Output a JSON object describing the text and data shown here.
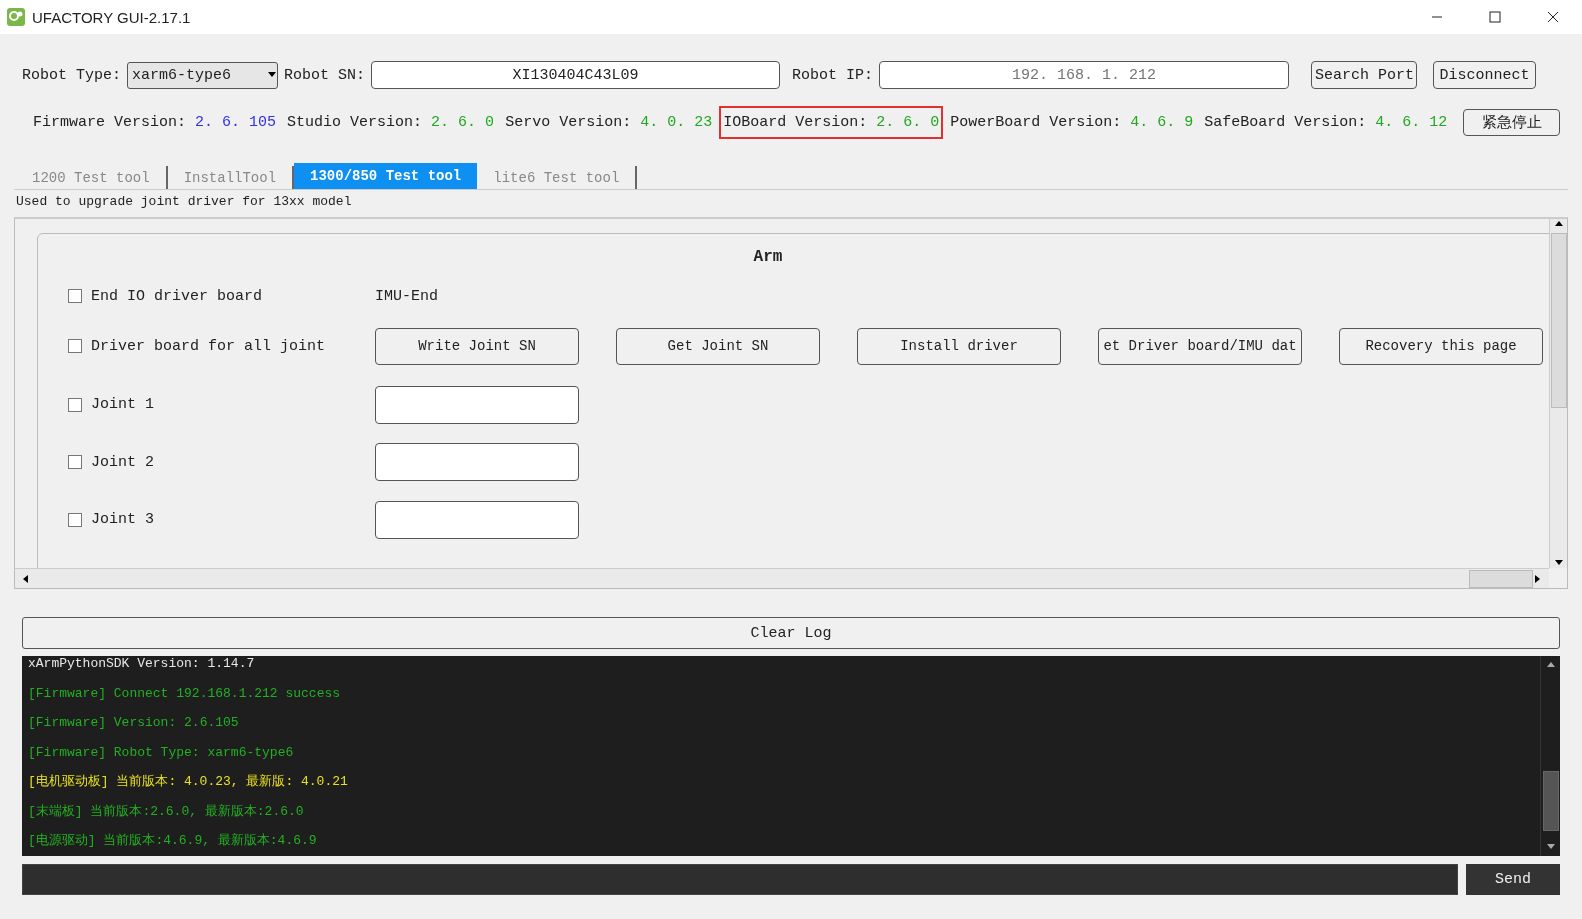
{
  "window": {
    "title": "UFACTORY GUI-2.17.1"
  },
  "connection": {
    "robot_type_label": "Robot Type:",
    "robot_type": "xarm6-type6",
    "robot_sn_label": "Robot SN:",
    "robot_sn": "XI130404C43L09",
    "robot_ip_label": "Robot IP:",
    "robot_ip_placeholder": "192. 168. 1. 212",
    "buttons": [
      "Search Port",
      "Disconnect"
    ]
  },
  "versions": [
    {
      "label": "Firmware Version:",
      "value": "2. 6. 105",
      "color": "#3030e8",
      "highlighted": false
    },
    {
      "label": "Studio Version:",
      "value": "2. 6. 0",
      "color": "#1fa81f",
      "highlighted": false
    },
    {
      "label": "Servo Version:",
      "value": "4. 0. 23",
      "color": "#1fa81f",
      "highlighted": false
    },
    {
      "label": "IOBoard Version:",
      "value": "2. 6. 0",
      "color": "#1fa81f",
      "highlighted": true
    },
    {
      "label": "PowerBoard Version:",
      "value": "4. 6. 9",
      "color": "#1fa81f",
      "highlighted": false
    },
    {
      "label": "SafeBoard Version:",
      "value": "4. 6. 12",
      "color": "#1fa81f",
      "highlighted": false
    }
  ],
  "emergency_stop": "紧急停止",
  "tabs": [
    {
      "label": "1200 Test tool",
      "selected": false
    },
    {
      "label": "InstallTool",
      "selected": false
    },
    {
      "label": "1300/850 Test tool",
      "selected": true
    },
    {
      "label": "lite6 Test tool",
      "selected": false
    }
  ],
  "description": "Used to upgrade joint driver for 13xx model",
  "arm": {
    "title": "Arm",
    "rows": [
      {
        "kind": "text",
        "label": "End IO driver board",
        "checked": false,
        "text": "IMU-End"
      },
      {
        "kind": "buttons",
        "label": "Driver board for all joint",
        "checked": false,
        "buttons": [
          "Write Joint SN",
          "Get Joint SN",
          "Install driver",
          "et Driver board/IMU dat",
          "Recovery this page"
        ]
      },
      {
        "kind": "field",
        "label": "Joint 1",
        "checked": false
      },
      {
        "kind": "field",
        "label": "Joint 2",
        "checked": false
      },
      {
        "kind": "field",
        "label": "Joint 3",
        "checked": false
      }
    ]
  },
  "clear_log": "Clear Log",
  "log": [
    {
      "text": "xArmPythonSDK Version: 1.14.7",
      "color": "#e8e8e8"
    },
    {
      "text": "[Firmware] Connect 192.168.1.212 success",
      "color": "#22b022"
    },
    {
      "text": "[Firmware] Version: 2.6.105",
      "color": "#22b022"
    },
    {
      "text": "[Firmware] Robot Type: xarm6-type6",
      "color": "#22b022"
    },
    {
      "text": "[电机驱动板] 当前版本: 4.0.23, 最新版: 4.0.21",
      "color": "#e8e020"
    },
    {
      "text": "[末端板] 当前版本:2.6.0, 最新版本:2.6.0",
      "color": "#22b022"
    },
    {
      "text": "[电源驱动] 当前版本:4.6.9, 最新版本:4.6.9",
      "color": "#22b022"
    }
  ],
  "send": "Send"
}
